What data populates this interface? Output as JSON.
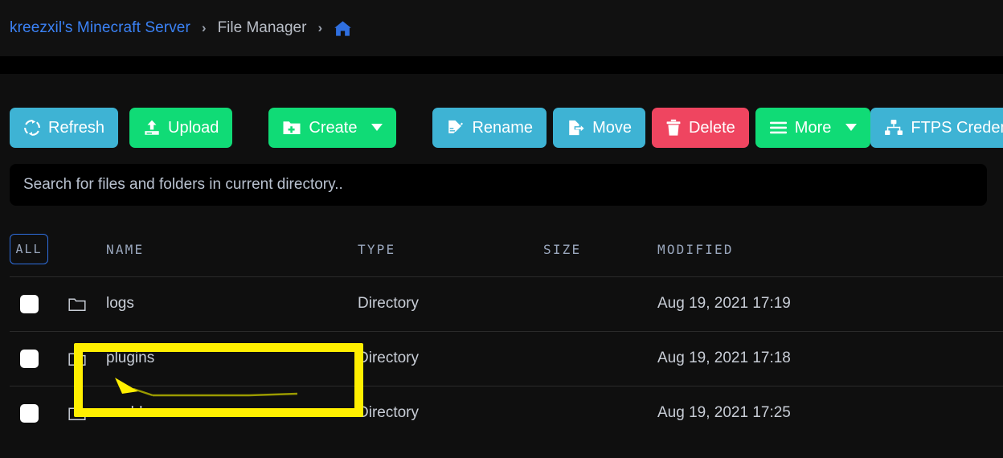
{
  "breadcrumb": {
    "server_link": "kreezxil's Minecraft Server",
    "separator": "›",
    "current": "File Manager",
    "home_icon": "home-icon"
  },
  "toolbar": {
    "refresh": {
      "label": "Refresh",
      "icon": "refresh-icon",
      "color": "#3eb3d4"
    },
    "upload": {
      "label": "Upload",
      "icon": "upload-icon",
      "color": "#10db76"
    },
    "create": {
      "label": "Create",
      "icon": "folder-plus-icon",
      "color": "#10db76",
      "has_caret": true
    },
    "rename": {
      "label": "Rename",
      "icon": "file-pencil-icon",
      "color": "#3eb3d4"
    },
    "move": {
      "label": "Move",
      "icon": "file-export-icon",
      "color": "#3eb3d4"
    },
    "delete": {
      "label": "Delete",
      "icon": "trash-icon",
      "color": "#ef4560"
    },
    "more": {
      "label": "More",
      "icon": "hamburger-icon",
      "color": "#10db76",
      "has_caret": true
    },
    "ftps": {
      "label": "FTPS Credentials",
      "icon": "sitemap-icon",
      "color": "#3eb3d4"
    }
  },
  "search": {
    "placeholder": "Search for files and folders in current directory..",
    "value": ""
  },
  "table": {
    "select_all_label": "ALL",
    "headers": {
      "name": "NAME",
      "type": "TYPE",
      "size": "SIZE",
      "modified": "MODIFIED"
    },
    "rows": [
      {
        "name": "logs",
        "type": "Directory",
        "size": "",
        "modified": "Aug 19, 2021 17:19",
        "icon": "folder-icon",
        "checked": false
      },
      {
        "name": "plugins",
        "type": "Directory",
        "size": "",
        "modified": "Aug 19, 2021 17:18",
        "icon": "folder-icon",
        "checked": false
      },
      {
        "name": "world",
        "type": "Directory",
        "size": "",
        "modified": "Aug 19, 2021 17:25",
        "icon": "folder-icon",
        "checked": false
      }
    ]
  },
  "annotation": {
    "highlight_color": "#ffef00",
    "arrow_color": "#ffef00",
    "arrow_tail_color": "#9a9a00",
    "target_row": "plugins"
  }
}
